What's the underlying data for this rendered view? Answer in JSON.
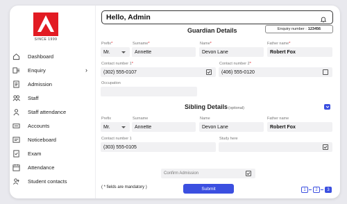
{
  "brand": {
    "since_text": "SINCE 1999"
  },
  "sidebar": {
    "items": [
      {
        "label": "Dashboard",
        "icon": "home-icon"
      },
      {
        "label": "Enquiry",
        "icon": "enquiry-icon",
        "chevron": "›"
      },
      {
        "label": "Admission",
        "icon": "admission-icon"
      },
      {
        "label": "Staff",
        "icon": "staff-icon"
      },
      {
        "label": "Staff attendance",
        "icon": "staff-attendance-icon"
      },
      {
        "label": "Accounts",
        "icon": "accounts-icon"
      },
      {
        "label": "Noticeboard",
        "icon": "noticeboard-icon"
      },
      {
        "label": "Exam",
        "icon": "exam-icon"
      },
      {
        "label": "Attendance",
        "icon": "attendance-icon"
      },
      {
        "label": "Student contacts",
        "icon": "student-contacts-icon"
      }
    ]
  },
  "header": {
    "greeting": "Hello, Admin",
    "icon": "bell-icon"
  },
  "guardian": {
    "title": "Guardian Details",
    "enquiry_label": "Enquiry number :",
    "enquiry_number": "123456",
    "prefix_label": "Prefix",
    "prefix_value": "Mr.",
    "surname_label": "Surname",
    "surname_value": "Annette",
    "name_label": "Name",
    "name_value": "Devon Lane",
    "father_label": "Father name",
    "father_value": "Robert Fox",
    "contact1_label": "Contact number 1",
    "contact1_value": "(302) 555-0107",
    "contact2_label": "Contact number 2",
    "contact2_value": "(406) 555-0120",
    "occupation_label": "Occupation",
    "occupation_value": ""
  },
  "sibling": {
    "title": "Sibling Details",
    "optional": "(optional)",
    "prefix_label": "Prefix",
    "prefix_value": "Mr.",
    "surname_label": "Surname",
    "surname_value": "Annette",
    "name_label": "Name",
    "name_value": "Devon Lane",
    "father_label": "Father name",
    "father_value": "Robert Fox",
    "contact1_label": "Contact number 1",
    "contact1_value": "(303) 555-0105",
    "study_label": "Study here",
    "study_value": ""
  },
  "footer": {
    "confirm_label": "Confirm Admission",
    "mandatory_note": "( * fields are mandatory )",
    "submit_label": "Submit",
    "pages": [
      "1",
      "2",
      "3"
    ],
    "active_page": "3"
  },
  "colors": {
    "accent": "#3b4fe0",
    "brand_red": "#e21b23"
  }
}
